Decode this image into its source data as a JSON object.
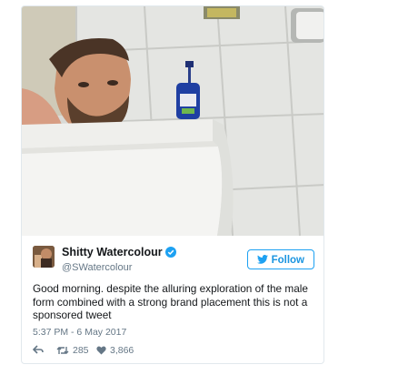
{
  "tweet": {
    "display_name": "Shitty Watercolour",
    "handle": "@SWatercolour",
    "follow_label": "Follow",
    "text": "Good morning. despite the alluring exploration of the male form combined with a strong brand placement this is not a sponsored tweet",
    "timestamp": "5:37 PM - 6 May 2017",
    "retweets": "285",
    "likes": "3,866"
  },
  "colors": {
    "accent": "#1da1f2",
    "verified": "#1da1f2",
    "text": "#14171a",
    "muted": "#657786"
  },
  "icons": [
    "verified-badge-icon",
    "twitter-bird-icon",
    "reply-icon",
    "retweet-icon",
    "heart-icon"
  ]
}
